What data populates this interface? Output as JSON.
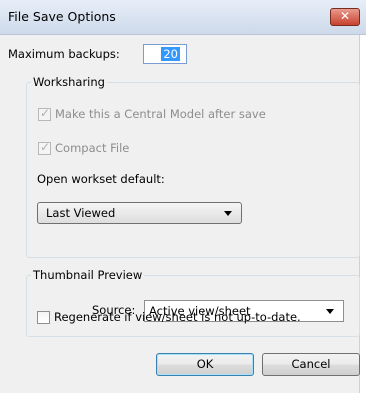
{
  "window": {
    "title": "File Save Options",
    "close_glyph": "✕"
  },
  "backups": {
    "label": "Maximum backups:",
    "value": "20"
  },
  "worksharing": {
    "legend": "Worksharing",
    "central_model_label": "Make this a Central Model after save",
    "central_model_checked": true,
    "compact_label": "Compact File",
    "compact_checked": true,
    "open_default_label": "Open workset default:",
    "open_default_value": "Last Viewed"
  },
  "thumbnail": {
    "legend": "Thumbnail Preview",
    "source_label": "Source:",
    "source_value": "Active view/sheet",
    "regenerate_label": "Regenerate if view/sheet is not up-to-date.",
    "regenerate_checked": false
  },
  "buttons": {
    "ok": "OK",
    "cancel": "Cancel"
  },
  "icons": {
    "check": "✓"
  }
}
